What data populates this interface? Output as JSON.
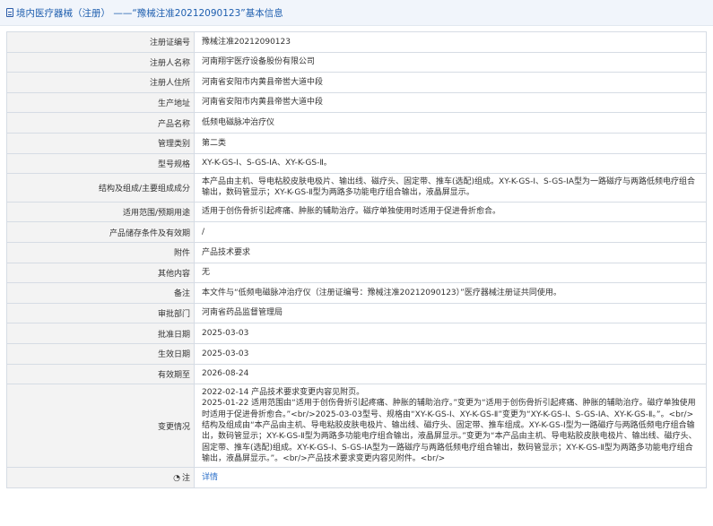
{
  "header": {
    "title": "境内医疗器械（注册） ——“豫械注准20212090123”基本信息",
    "icon": "document-icon"
  },
  "rows": [
    {
      "label": "注册证编号",
      "value": "豫械注准20212090123"
    },
    {
      "label": "注册人名称",
      "value": "河南翔宇医疗设备股份有限公司"
    },
    {
      "label": "注册人住所",
      "value": "河南省安阳市内黄县帝喾大道中段"
    },
    {
      "label": "生产地址",
      "value": "河南省安阳市内黄县帝喾大道中段"
    },
    {
      "label": "产品名称",
      "value": "低频电磁脉冲治疗仪"
    },
    {
      "label": "管理类别",
      "value": "第二类"
    },
    {
      "label": "型号规格",
      "value": "XY-K-GS-Ⅰ、S-GS-ⅠA、XY-K-GS-Ⅱ。"
    },
    {
      "label": "结构及组成/主要组成成分",
      "value": "本产品由主机、导电粘胶皮肤电极片、输出线、磁疗头、固定带、推车(选配)组成。XY-K-GS-Ⅰ、S-GS-ⅠA型为一路磁疗与两路低频电疗组合输出，数码管显示；XY-K-GS-Ⅱ型为两路多功能电疗组合输出，液晶屏显示。"
    },
    {
      "label": "适用范围/预期用途",
      "value": "适用于创伤骨折引起疼痛、肿胀的辅助治疗。磁疗单独使用时适用于促进骨折愈合。"
    },
    {
      "label": "产品储存条件及有效期",
      "value": "/"
    },
    {
      "label": "附件",
      "value": "产品技术要求"
    },
    {
      "label": "其他内容",
      "value": "无"
    },
    {
      "label": "备注",
      "value": "本文件与“低频电磁脉冲治疗仪（注册证编号：豫械注准20212090123）”医疗器械注册证共同使用。"
    },
    {
      "label": "审批部门",
      "value": "河南省药品监督管理局"
    },
    {
      "label": "批准日期",
      "value": "2025-03-03"
    },
    {
      "label": "生效日期",
      "value": "2025-03-03"
    },
    {
      "label": "有效期至",
      "value": "2026-08-24"
    }
  ],
  "change": {
    "label": "变更情况",
    "lines": [
      "2022-02-14 产品技术要求变更内容见附页。",
      "2025-01-22 适用范围由“适用于创伤骨折引起疼痛、肿胀的辅助治疗。”变更为“适用于创伤骨折引起疼痛、肿胀的辅助治疗。磁疗单独使用时适用于促进骨折愈合。”<br/>2025-03-03型号、规格由“XY-K-GS-Ⅰ、XY-K-GS-Ⅱ”变更为“XY-K-GS-Ⅰ、S-GS-ⅠA、XY-K-GS-Ⅱ。”。<br/>结构及组成由“本产品由主机、导电粘胶皮肤电极片、输出线、磁疗头、固定带、推车组成。XY-K-GS-Ⅰ型为一路磁疗与两路低频电疗组合输出，数码管显示；XY-K-GS-Ⅱ型为两路多功能电疗组合输出，液晶屏显示。”变更为“本产品由主机、导电粘胶皮肤电极片、输出线、磁疗头、固定带、推车(选配)组成。XY-K-GS-Ⅰ、S-GS-ⅠA型为一路磁疗与两路低频电疗组合输出，数码管显示；XY-K-GS-Ⅱ型为两路多功能电疗组合输出，液晶屏显示。”。<br/>产品技术要求变更内容见附件。<br/>"
    ]
  },
  "note": {
    "label": "注",
    "icon": "note-icon",
    "link_text": "详情"
  }
}
